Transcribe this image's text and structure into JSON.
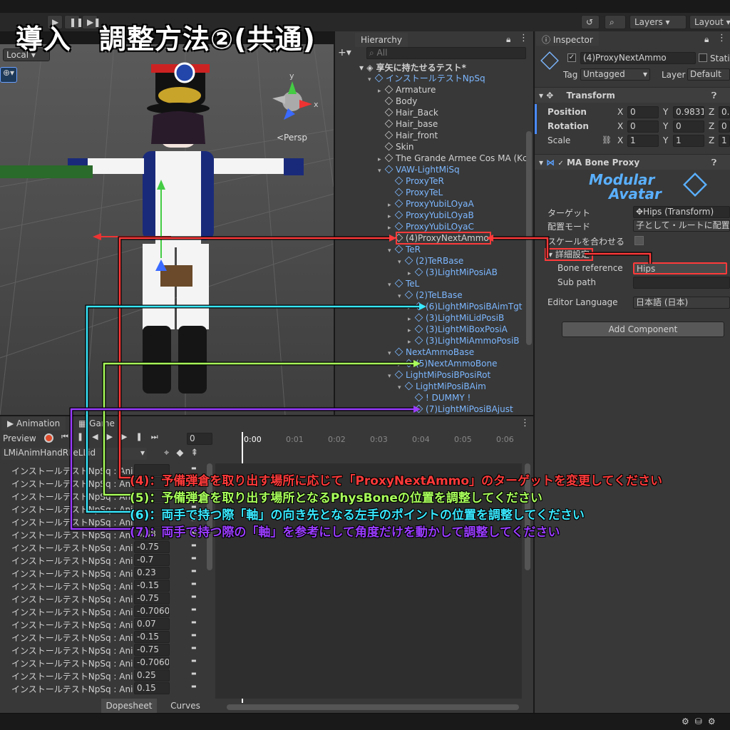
{
  "banner_title": "導入　調整方法②(共通)",
  "toolbar": {
    "history_icon": "history-icon",
    "search_icon": "search-icon",
    "layers_label": "Layers",
    "layout_label": "Layout"
  },
  "scene": {
    "pivot_label": "Local",
    "persp_label": "<Persp",
    "axis_y": "y",
    "axis_x": "x"
  },
  "hierarchy": {
    "tab_label": "Hierarchy",
    "search_placeholder": "All",
    "scene_name": "享矢に持たせるテスト*",
    "items": [
      {
        "label": "インストールテストNpSq",
        "prefab": true
      },
      {
        "label": "Armature"
      },
      {
        "label": "Body"
      },
      {
        "label": "Hair_Back"
      },
      {
        "label": "Hair_base"
      },
      {
        "label": "Hair_front"
      },
      {
        "label": "Skin"
      },
      {
        "label": "The Grande Armee Cos MA (Kc"
      },
      {
        "label": "VAW-LightMiSq",
        "prefab": true
      },
      {
        "label": "ProxyTeR",
        "prefab": true
      },
      {
        "label": "ProxyTeL",
        "prefab": true
      },
      {
        "label": "ProxyYubiLOyaA",
        "prefab": true
      },
      {
        "label": "ProxyYubiLOyaB",
        "prefab": true
      },
      {
        "label": "ProxyYubiLOyaC",
        "prefab": true
      },
      {
        "label": "(4)ProxyNextAmmo"
      },
      {
        "label": "TeR",
        "prefab": true
      },
      {
        "label": "(2)TeRBase",
        "prefab": true
      },
      {
        "label": "(3)LightMiPosiAB",
        "prefab": true
      },
      {
        "label": "TeL",
        "prefab": true
      },
      {
        "label": "(2)TeLBase",
        "prefab": true
      },
      {
        "label": "(6)LightMiPosiBAimTgt",
        "prefab": true
      },
      {
        "label": "(3)LightMiLidPosiB",
        "prefab": true
      },
      {
        "label": "(3)LightMiBoxPosiA",
        "prefab": true
      },
      {
        "label": "(3)LightMiAmmoPosiB",
        "prefab": true
      },
      {
        "label": "NextAmmoBase",
        "prefab": true
      },
      {
        "label": "(5)NextAmmoBone",
        "prefab": true
      },
      {
        "label": "LightMiPosiBPosiRot",
        "prefab": true
      },
      {
        "label": "LightMiPosiBAim",
        "prefab": true
      },
      {
        "label": "! DUMMY !",
        "prefab": true
      },
      {
        "label": "(7)LightMiPosiBAjust",
        "prefab": true
      }
    ]
  },
  "inspector": {
    "tab_label": "Inspector",
    "object_name": "(4)ProxyNextAmmo",
    "static_label": "Stati",
    "tag_label": "Tag",
    "tag_value": "Untagged",
    "layer_label": "Layer",
    "layer_value": "Default",
    "transform_title": "Transform",
    "position_label": "Position",
    "rotation_label": "Rotation",
    "scale_label": "Scale",
    "pos": {
      "x": "0",
      "y": "0.9831",
      "z": "0."
    },
    "rot": {
      "x": "0",
      "y": "0",
      "z": "0"
    },
    "scl": {
      "x": "1",
      "y": "1",
      "z": "1"
    },
    "axis": {
      "x": "X",
      "y": "Y",
      "z": "Z"
    },
    "component_title": "MA Bone Proxy",
    "logo_line1": "Modular",
    "logo_line2": "Avatar",
    "target_label": "ターゲット",
    "target_value": "Hips (Transform)",
    "mode_label": "配置モード",
    "mode_value": "子として・ルートに配置",
    "scale_match_label": "スケールを合わせる",
    "advanced_label": "詳細設定",
    "bone_ref_label": "Bone reference",
    "bone_ref_value": "Hips",
    "subpath_label": "Sub path",
    "subpath_value": "",
    "editor_lang_label": "Editor Language",
    "editor_lang_value": "日本語 (日本)",
    "add_component": "Add Component"
  },
  "animation": {
    "tab_anim": "Animation",
    "tab_game": "Game",
    "preview_label": "Preview",
    "frame_value": "0",
    "clip_name": "LMiAnimHandRFeLLid",
    "timeline": [
      "0:00",
      "0:01",
      "0:02",
      "0:03",
      "0:04",
      "0:05",
      "0:06"
    ],
    "property_prefix": "インストールテストNpSq : Anima",
    "values": [
      "",
      "",
      "",
      "",
      "",
      "0.48",
      "-0.75",
      "-0.7",
      "0.23",
      "-0.15",
      "-0.75",
      "-0.7060",
      "0.07",
      "-0.15",
      "-0.75",
      "-0.7060",
      "0.25",
      "0.15"
    ],
    "dopesheet": "Dopesheet",
    "curves": "Curves"
  },
  "notes": [
    {
      "text": "(4)：予備弾倉を取り出す場所に応じて「ProxyNextAmmo」のターゲットを変更してください",
      "color": "#ff3a3a"
    },
    {
      "text": "(5)：予備弾倉を取り出す場所となるPhysBoneの位置を調整してください",
      "color": "#a8ff5a"
    },
    {
      "text": "(6)：両手で持つ際「軸」の向き先となる左手のポイントの位置を調整してください",
      "color": "#38e8ff"
    },
    {
      "text": "(7)：両手で持つ際の「軸」を参考にして角度だけを動かして調整してください",
      "color": "#9a3cff"
    }
  ],
  "colors": {
    "red": "#ff3a3a",
    "green": "#a8ff5a",
    "cyan": "#38e8ff",
    "purple": "#9a3cff",
    "prefab": "#7cb7ff"
  }
}
